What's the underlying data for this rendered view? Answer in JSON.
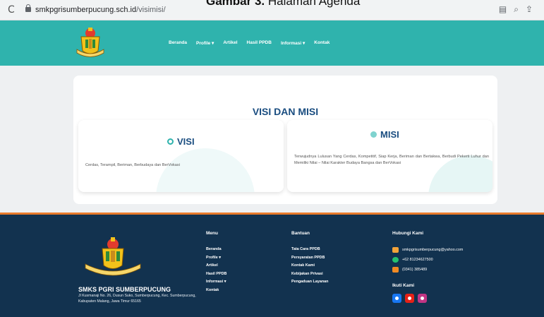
{
  "caption": {
    "bold": "Gambar 3.",
    "rest": "Halaman Agenda"
  },
  "browser": {
    "url_host": "smkpgrisumberpucung.sch.id",
    "url_path": "/visimisi/"
  },
  "nav": {
    "items": [
      {
        "label": "Beranda"
      },
      {
        "label": "Profile ▾"
      },
      {
        "label": "Artikel"
      },
      {
        "label": "Hasil PPDB"
      },
      {
        "label": "Informasi ▾"
      },
      {
        "label": "Kontak"
      }
    ]
  },
  "content": {
    "title": "VISI DAN MISI",
    "visi": {
      "heading": "VISI",
      "text": "Cerdas, Terampil, Beriman, Berbudaya dan BerVokasi"
    },
    "misi": {
      "heading": "MISI",
      "text": "Terwujudnya Lulusan Yang Cerdas, Kompetitif, Siap Kerja, Beriman dan Bertakwa, Berbudi Pekerti Luhur dan Memiliki Nilai – Nilai Karakter Budaya Bangsa dan BerVokasi"
    }
  },
  "footer": {
    "school_name": "SMKS PGRI SUMBERPUCUNG",
    "address": "Jl Kusmanaji No. 26, Dusun Suko, Sumberpucung, Kec. Sumberpucung, Kabupaten Malang, Jawa Timur 65165",
    "menu": {
      "heading": "Menu",
      "items": [
        "Beranda",
        "Profile ▾",
        "Artikel",
        "Hasil PPDB",
        "Informasi ▾",
        "Kontak"
      ]
    },
    "bantuan": {
      "heading": "Bantuan",
      "items": [
        "Tata Cara PPDB",
        "Persyaratan PPDB",
        "Kontak Kami",
        "Kebijakan Privasi",
        "Pengaduan Layanan"
      ]
    },
    "hubungi": {
      "heading": "Hubungi Kami",
      "email": "smkpgrisumberpucung@yahoo.com",
      "whatsapp": "+62 81234627500",
      "phone": "(0341) 385489"
    },
    "ikuti": {
      "heading": "Ikuti Kami"
    }
  },
  "colors": {
    "nav_bg": "#2fb3ad",
    "footer_bg": "#12324f",
    "title": "#1a4d80",
    "accent_orange": "#e87a2b"
  }
}
